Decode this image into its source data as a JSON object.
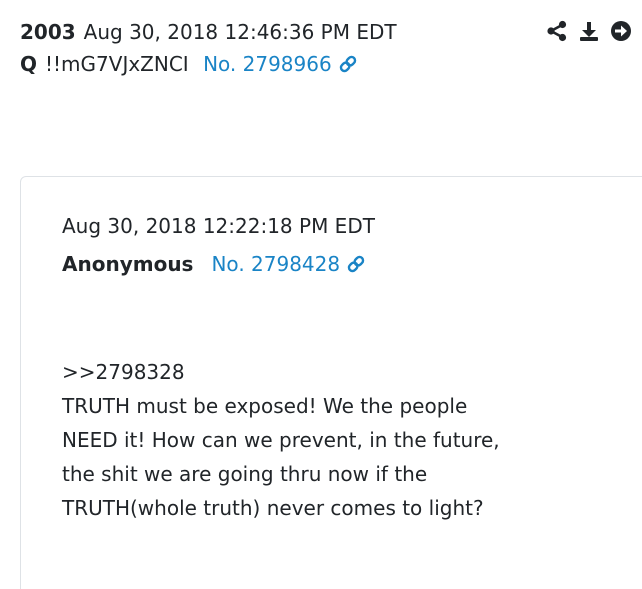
{
  "post": {
    "number": "2003",
    "date": "Aug 30, 2018 12:46:36 PM EDT",
    "author": "Q",
    "tripcode": "!!mG7VJxZNCI",
    "post_no": "No. 2798966"
  },
  "actions": {
    "icons": [
      "share-icon",
      "download-icon",
      "open-icon"
    ]
  },
  "quote": {
    "date": "Aug 30, 2018 12:22:18 PM EDT",
    "author": "Anonymous",
    "post_no": "No. 2798428",
    "lines": [
      ">>2798328",
      "TRUTH must be exposed!  We the people",
      "NEED it!  How can we prevent, in the future,",
      "the shit we are going thru now if the",
      "TRUTH(whole truth) never comes to light?"
    ]
  },
  "colors": {
    "link": "#1a84c6",
    "text": "#212529",
    "border": "#dee2e6"
  }
}
